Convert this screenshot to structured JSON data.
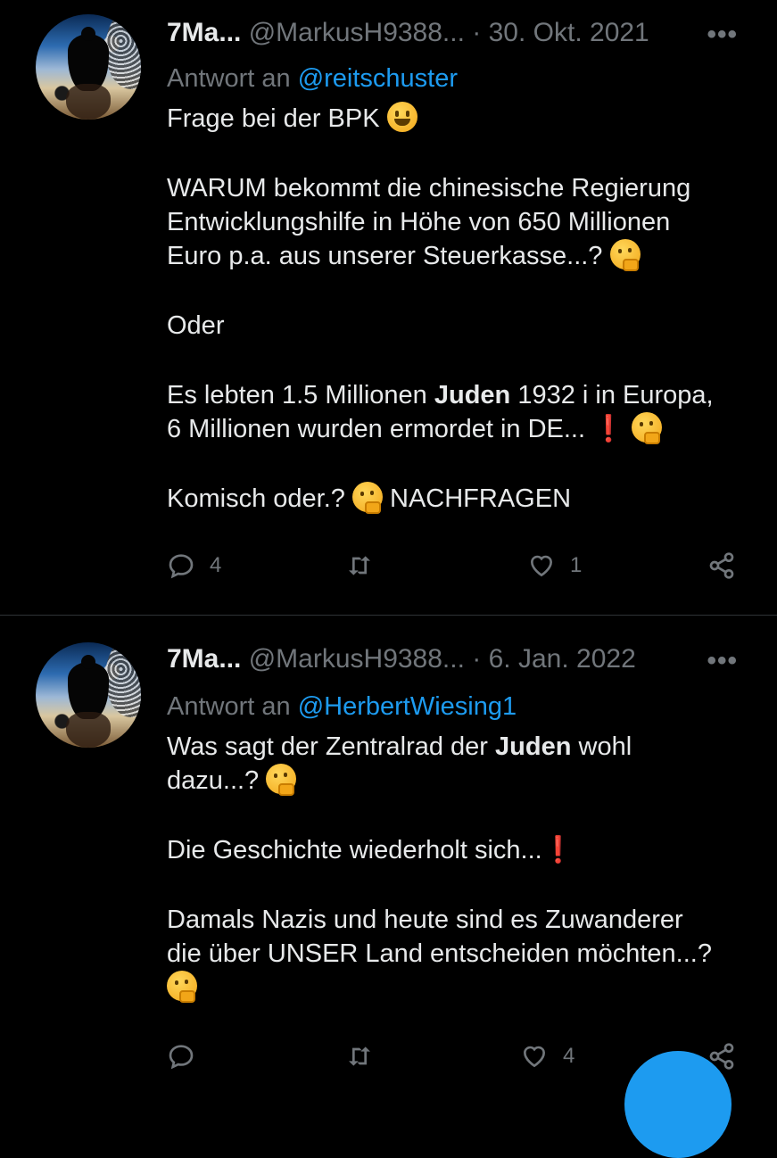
{
  "tweets": [
    {
      "name": "7Ma...",
      "handle": "@MarkusH9388...",
      "dot": "·",
      "date": "30. Okt. 2021",
      "more": "•••",
      "reply_prefix": "Antwort an",
      "reply_to": "@reitschuster",
      "lines": {
        "l1": "Frage bei der BPK",
        "l2a": "WARUM bekommt die chinesische Regierung",
        "l2b": "Entwicklungshilfe in Höhe von 650 Millionen",
        "l2c": "Euro p.a. aus unserer Steuerkasse...?",
        "l3": "Oder",
        "l4a_pre": "Es lebten 1.5 Millionen",
        "l4a_bold": "Juden",
        "l4a_post": "1932 i in Europa,",
        "l4b": "6 Millionen wurden ermordet in DE...",
        "l5_pre": "Komisch oder.?",
        "l5_post": "NACHFRAGEN"
      },
      "exclamation": "❗",
      "replies": "4",
      "retweets": "",
      "likes": "1"
    },
    {
      "name": "7Ma...",
      "handle": "@MarkusH9388...",
      "dot": "·",
      "date": "6. Jan. 2022",
      "more": "•••",
      "reply_prefix": "Antwort an",
      "reply_to": "@HerbertWiesing1",
      "lines": {
        "l1_pre": "Was sagt der Zentralrad der",
        "l1_bold": "Juden",
        "l1_post": "wohl",
        "l2": "dazu...?",
        "l3": "Die Geschichte wiederholt sich...",
        "l4a": "Damals Nazis und heute sind es Zuwanderer",
        "l4b": "die über UNSER Land entscheiden möchten...?"
      },
      "exclamation": "❗",
      "replies": "",
      "retweets": "",
      "likes": "4"
    }
  ],
  "icons": [
    "reply-icon",
    "retweet-icon",
    "like-icon",
    "share-icon",
    "more-icon"
  ],
  "colors": {
    "background": "#000000",
    "text": "#e7e9ea",
    "muted": "#71767b",
    "link": "#1d9bf0",
    "divider": "#2f3336"
  }
}
